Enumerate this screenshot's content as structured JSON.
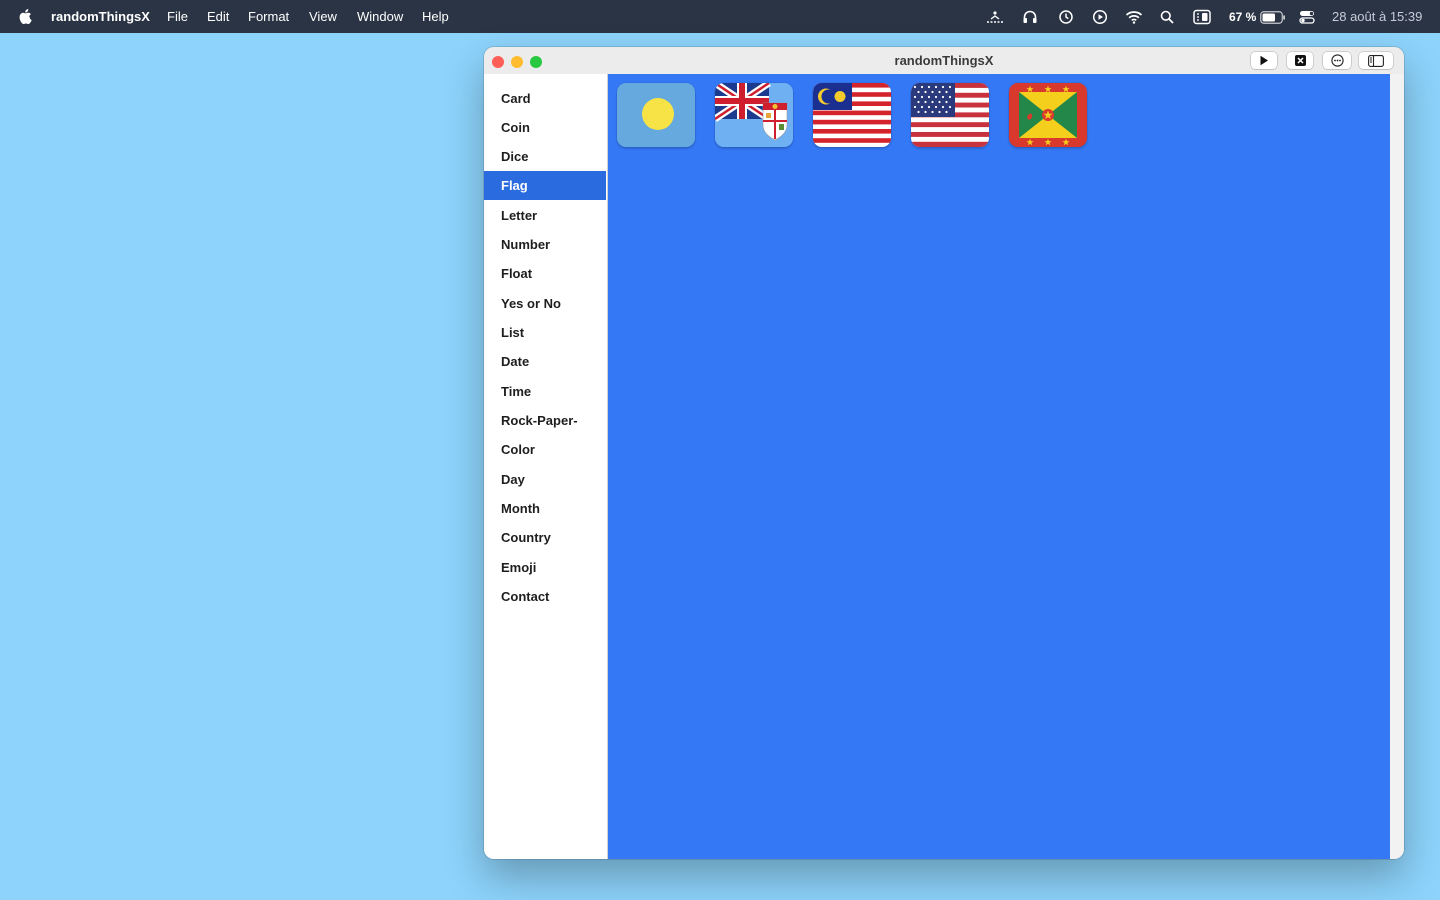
{
  "menubar": {
    "app_name": "randomThingsX",
    "menus": [
      "File",
      "Edit",
      "Format",
      "View",
      "Window",
      "Help"
    ],
    "battery_percent": "67 %",
    "clock": "28 août à 15:39"
  },
  "window": {
    "title": "randomThingsX"
  },
  "sidebar": {
    "items": [
      {
        "label": "Card"
      },
      {
        "label": "Coin"
      },
      {
        "label": "Dice"
      },
      {
        "label": "Flag",
        "selected": true
      },
      {
        "label": "Letter"
      },
      {
        "label": "Number"
      },
      {
        "label": "Float"
      },
      {
        "label": "Yes or No"
      },
      {
        "label": "List"
      },
      {
        "label": "Date"
      },
      {
        "label": "Time"
      },
      {
        "label": "Rock-Paper-"
      },
      {
        "label": "Color"
      },
      {
        "label": "Day"
      },
      {
        "label": "Month"
      },
      {
        "label": "Country"
      },
      {
        "label": "Emoji"
      },
      {
        "label": "Contact"
      }
    ]
  },
  "flags": [
    {
      "country": "Palau",
      "icon": "palau-flag-icon"
    },
    {
      "country": "Fiji",
      "icon": "fiji-flag-icon"
    },
    {
      "country": "Malaysia",
      "icon": "malaysia-flag-icon"
    },
    {
      "country": "United States",
      "icon": "usa-flag-icon"
    },
    {
      "country": "Grenada",
      "icon": "grenada-flag-icon"
    }
  ],
  "colors": {
    "desktop": "#8dd3fb",
    "content_background": "#3478f6",
    "selection": "#2b6be0",
    "menubar": "#2b3445"
  }
}
